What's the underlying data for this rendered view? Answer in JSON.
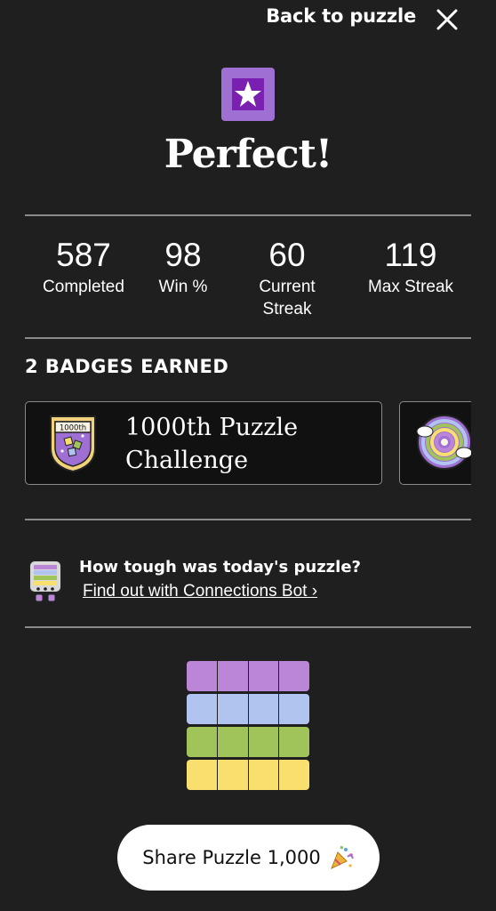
{
  "topbar": {
    "back_label": "Back to puzzle"
  },
  "header": {
    "title": "Perfect!"
  },
  "stats": [
    {
      "value": "587",
      "label": "Completed"
    },
    {
      "value": "98",
      "label": "Win %"
    },
    {
      "value": "60",
      "label": "Current Streak"
    },
    {
      "value": "119",
      "label": "Max Streak"
    }
  ],
  "badges": {
    "heading": "2 BADGES EARNED",
    "items": [
      {
        "name": "1000th Puzzle Challenge",
        "seal_text": "1000th"
      }
    ]
  },
  "bot": {
    "question": "How tough was today's puzzle?",
    "link": "Find out with Connections Bot ›"
  },
  "result_grid": {
    "colors": [
      "#bc86d8",
      "#b0c4ef",
      "#a0c35a",
      "#f9df6d"
    ],
    "columns": 4
  },
  "share": {
    "label": "Share Puzzle 1,000",
    "icon": "party-popper-icon"
  }
}
